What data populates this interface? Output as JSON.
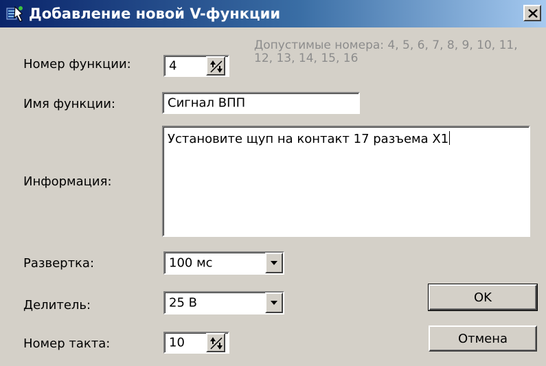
{
  "window": {
    "title": "Добавление новой V-функции",
    "icon": "app-icon",
    "close_icon": "close-icon"
  },
  "function_number": {
    "label": "Номер функции:",
    "value": "4",
    "hint": "Допустимые номера: 4, 5, 6, 7, 8, 9, 10, 11, 12, 13, 14, 15, 16"
  },
  "function_name": {
    "label": "Имя функции:",
    "value": "Сигнал ВПП"
  },
  "information": {
    "label": "Информация:",
    "value": "Установите щуп на контакт 17 разъема X1"
  },
  "sweep": {
    "label": "Развертка:",
    "value": "100 мс"
  },
  "divider": {
    "label": "Делитель:",
    "value": "25 В"
  },
  "cycle_number": {
    "label": "Номер такта:",
    "value": "10"
  },
  "buttons": {
    "ok": "OK",
    "cancel": "Отмена"
  }
}
